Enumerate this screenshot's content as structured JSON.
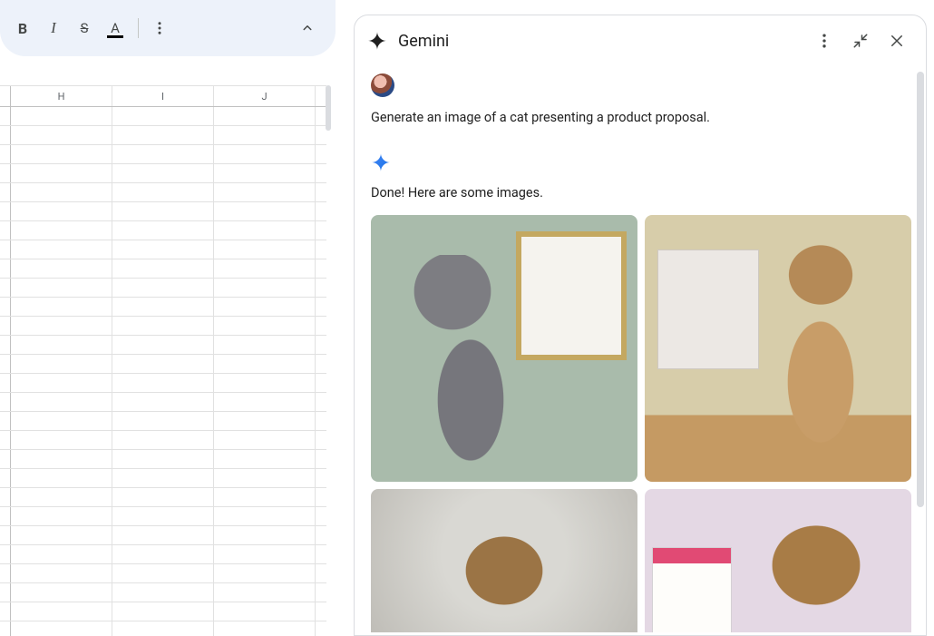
{
  "spreadsheet": {
    "columns": [
      "H",
      "I",
      "J"
    ],
    "toolbar": {
      "bold": "B",
      "italic": "I",
      "strike": "S",
      "text_color": "A"
    }
  },
  "gemini": {
    "title": "Gemini",
    "user_prompt": "Generate an image of a cat presenting a product proposal.",
    "response_text": "Done! Here are some images.",
    "images": [
      {
        "alt": "gray-cat-whiteboard"
      },
      {
        "alt": "tabby-cat-easel"
      },
      {
        "alt": "chubby-cat-portrait"
      },
      {
        "alt": "cat-with-clipboard"
      }
    ],
    "icons": {
      "spark": "gemini-spark-icon",
      "spark_blue": "gemini-spark-blue-icon",
      "more": "more-vert-icon",
      "minimize": "minimize-icon",
      "close": "close-icon"
    }
  }
}
